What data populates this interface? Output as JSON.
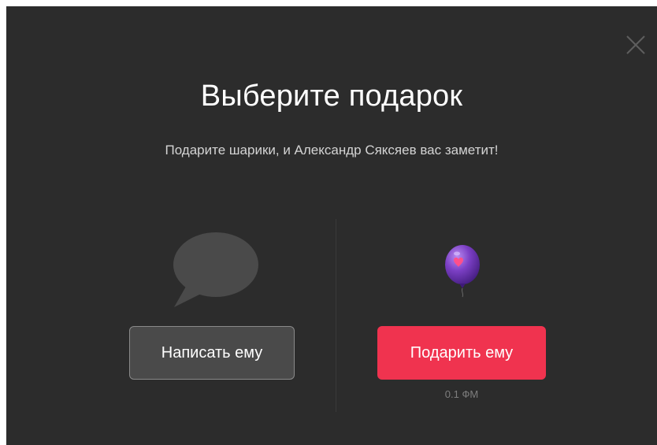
{
  "modal": {
    "title": "Выберите подарок",
    "subtitle": "Подарите шарики, и Александр Сяксяев вас заметит!",
    "close_icon": "close-icon"
  },
  "actions": {
    "message": {
      "icon": "chat-bubble-icon",
      "label": "Написать ему"
    },
    "gift": {
      "icon": "balloon-icon",
      "label": "Подарить ему",
      "price": "0.1 ФМ"
    }
  },
  "colors": {
    "modal_background": "#2c2c2c",
    "gift_button": "#f0334f",
    "message_button": "#4a4a4a",
    "chat_icon": "#4a4a4a",
    "balloon": "#7b3fc4"
  }
}
